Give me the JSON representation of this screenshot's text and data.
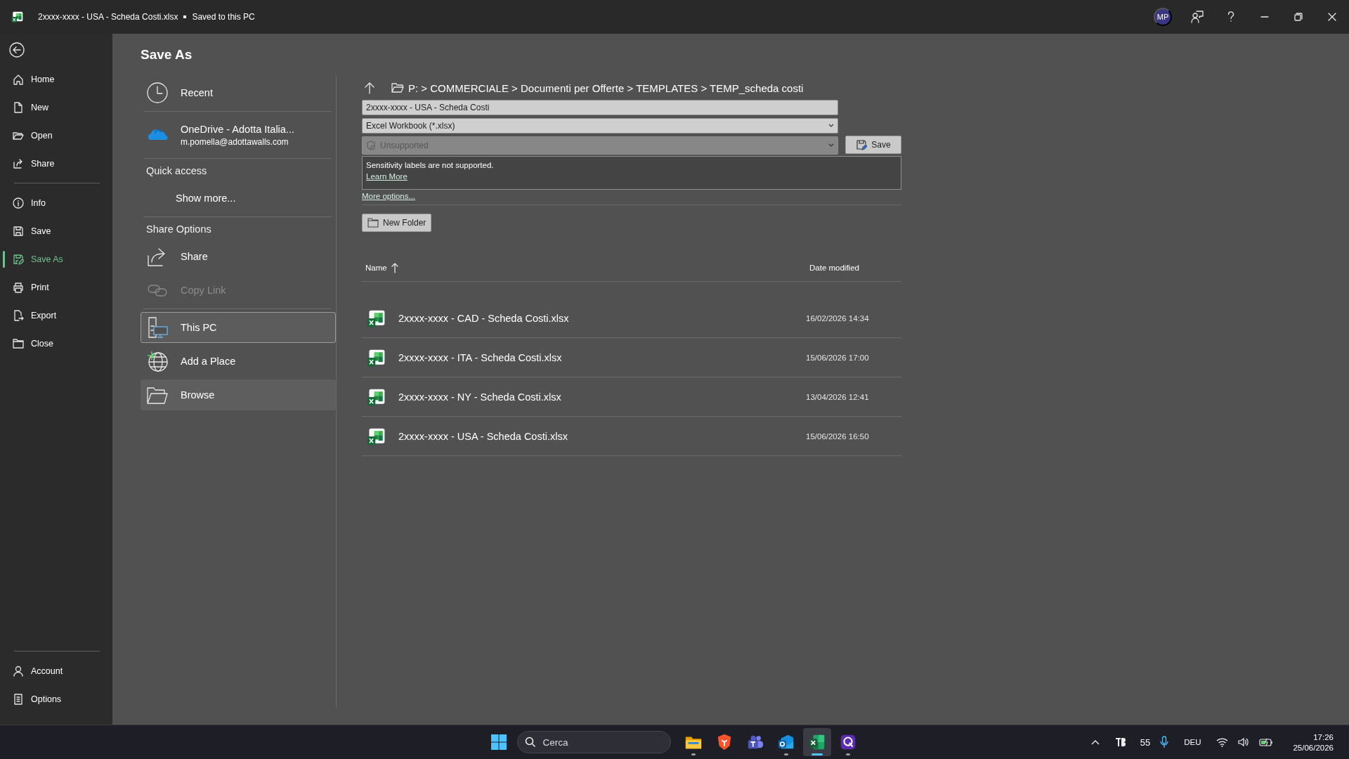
{
  "window": {
    "title": "2xxxx-xxxx - USA - Scheda Costi.xlsx",
    "status": "Saved to this PC",
    "avatar": "MP"
  },
  "nav": {
    "top": [
      {
        "label": "Home",
        "selected": false
      },
      {
        "label": "New",
        "selected": false
      },
      {
        "label": "Open",
        "selected": false
      },
      {
        "label": "Share",
        "selected": false
      }
    ],
    "main": [
      {
        "label": "Info",
        "selected": false
      },
      {
        "label": "Save",
        "selected": false
      },
      {
        "label": "Save As",
        "selected": true
      },
      {
        "label": "Print",
        "selected": false
      },
      {
        "label": "Export",
        "selected": false
      },
      {
        "label": "Close",
        "selected": false
      }
    ],
    "bottom": [
      {
        "label": "Account",
        "selected": false
      },
      {
        "label": "Options",
        "selected": false
      }
    ]
  },
  "page_title": "Save As",
  "places": {
    "sections": [
      {
        "items": [
          {
            "kind": "place",
            "label": "Recent",
            "selected": false,
            "hovered": false,
            "disabled": false
          }
        ]
      },
      {
        "items": [
          {
            "kind": "place",
            "label": "OneDrive - Adotta Italia...",
            "detail": "m.pomella@adottawalls.com",
            "selected": false,
            "hovered": false,
            "disabled": false
          }
        ]
      },
      {
        "heading": "Quick access",
        "items": [
          {
            "kind": "link",
            "label": "Show more...",
            "selected": false,
            "hovered": false,
            "disabled": false
          }
        ]
      },
      {
        "heading": "Share Options",
        "items": [
          {
            "kind": "place",
            "label": "Share",
            "selected": false,
            "hovered": false,
            "disabled": false
          },
          {
            "kind": "place",
            "label": "Copy Link",
            "selected": false,
            "hovered": false,
            "disabled": true
          }
        ]
      },
      {
        "items": [
          {
            "kind": "place",
            "label": "This PC",
            "selected": true,
            "hovered": false,
            "disabled": false
          },
          {
            "kind": "place",
            "label": "Add a Place",
            "selected": false,
            "hovered": false,
            "disabled": false
          },
          {
            "kind": "place",
            "label": "Browse",
            "selected": false,
            "hovered": true,
            "disabled": false
          }
        ]
      }
    ]
  },
  "save_form": {
    "path": "P: > COMMERCIALE > Documenti per Offerte > TEMPLATES > TEMP_scheda costi",
    "file_name": "2xxxx-xxxx - USA - Scheda Costi",
    "file_type": "Excel Workbook (*.xlsx)",
    "sensitivity": {
      "value": "Unsupported",
      "disabled": true
    },
    "save_button": "Save",
    "notice": "Sensitivity labels are not supported.",
    "learn_more": "Learn More",
    "more_options": "More options...",
    "new_folder": "New Folder"
  },
  "file_list": {
    "columns": [
      {
        "label": "Name",
        "sorted": true
      },
      {
        "label": "Date modified",
        "sorted": false
      }
    ],
    "rows": [
      {
        "name": "2xxxx-xxxx - CAD - Scheda Costi.xlsx",
        "modified": "16/02/2026 14:34"
      },
      {
        "name": "2xxxx-xxxx - ITA - Scheda Costi.xlsx",
        "modified": "15/06/2026 17:00"
      },
      {
        "name": "2xxxx-xxxx - NY - Scheda Costi.xlsx",
        "modified": "13/04/2026 12:41"
      },
      {
        "name": "2xxxx-xxxx - USA - Scheda Costi.xlsx",
        "modified": "15/06/2026 16:50"
      }
    ]
  },
  "taskbar": {
    "search": {
      "placeholder": "Cerca"
    },
    "apps": [
      {
        "running": true,
        "selected": false
      },
      {
        "running": false,
        "selected": false
      },
      {
        "running": false,
        "selected": false
      },
      {
        "running": true,
        "selected": false
      },
      {
        "running": true,
        "selected": true
      },
      {
        "running": true,
        "selected": false
      }
    ],
    "tray": {
      "temperature": "55",
      "language": "DEU",
      "time": "17:26",
      "date": "25/06/2026"
    }
  }
}
